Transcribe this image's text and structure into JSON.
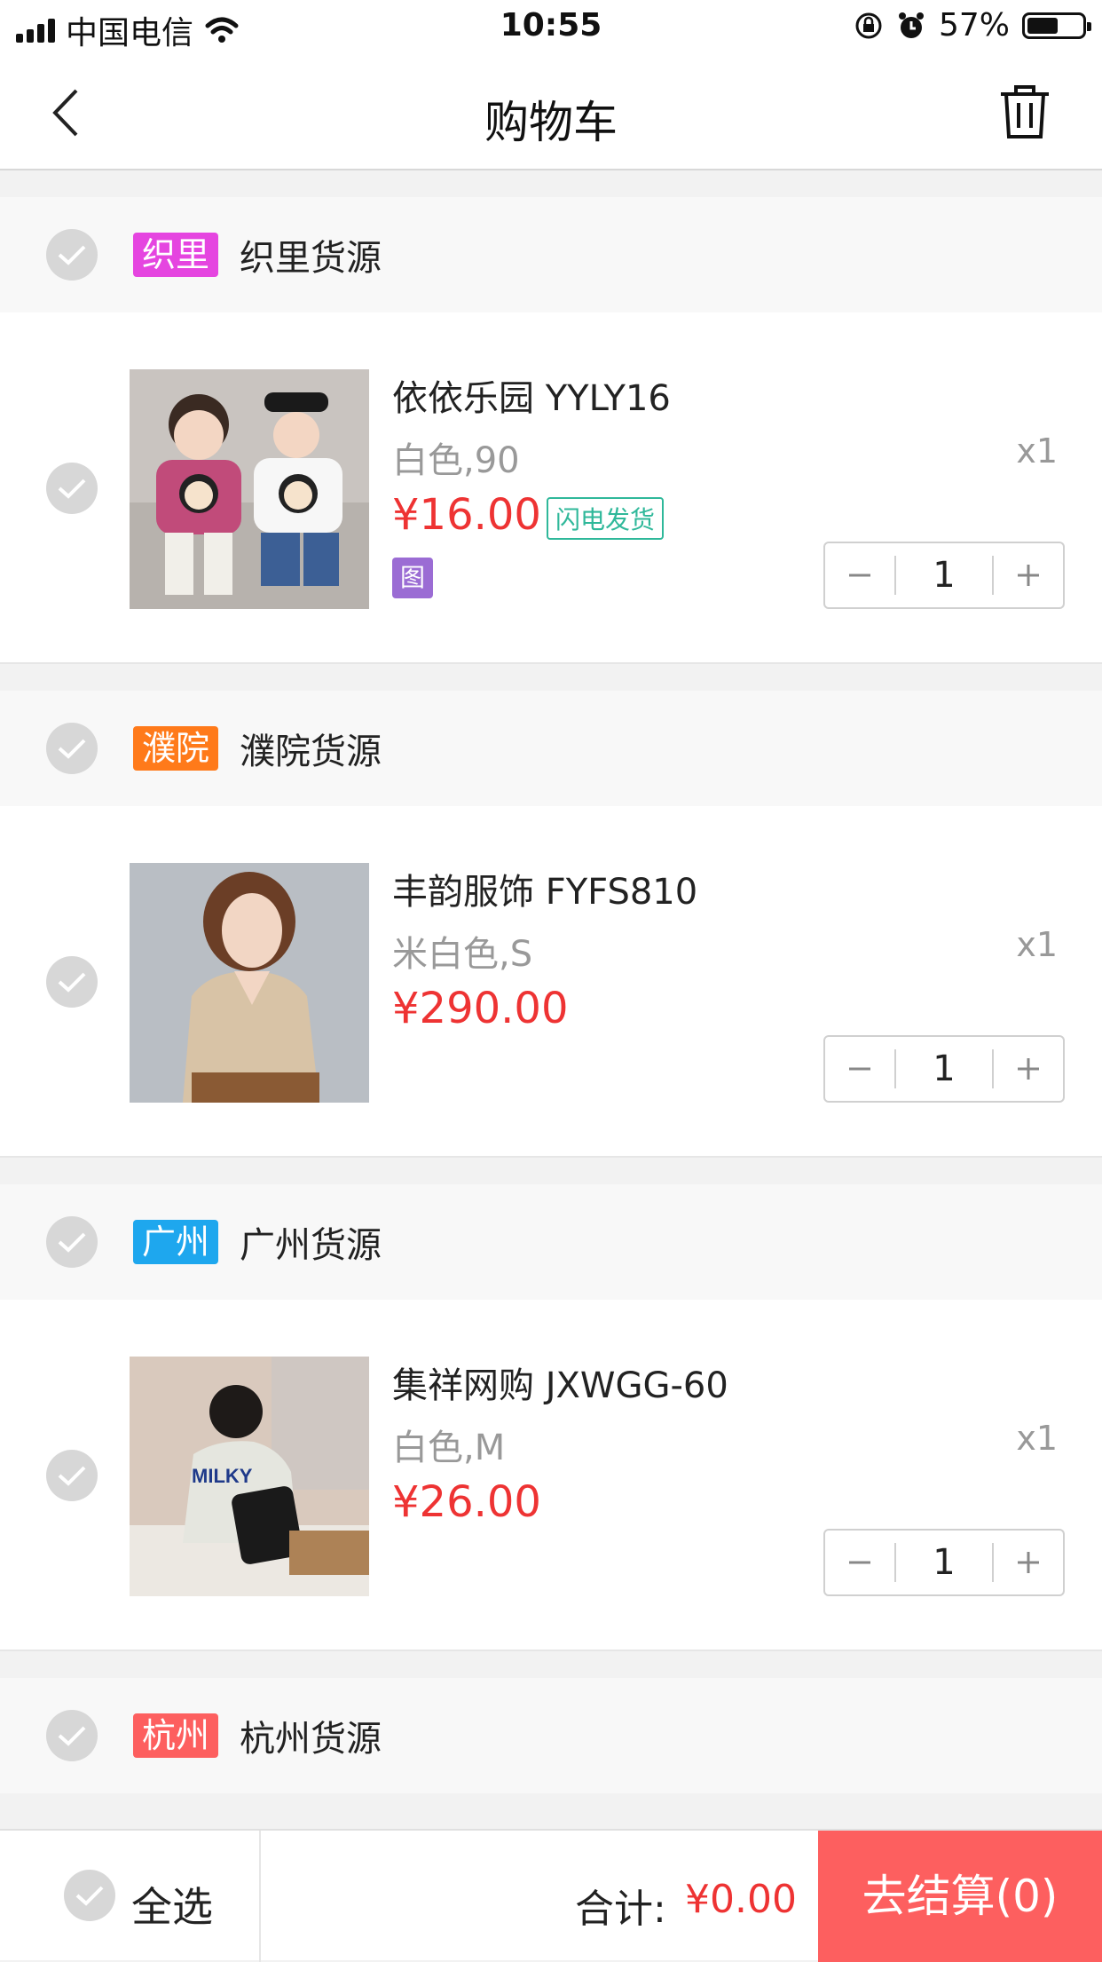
{
  "status_bar": {
    "carrier": "中国电信",
    "time": "10:55",
    "battery": "57%",
    "battery_level": 0.57
  },
  "nav": {
    "title": "购物车",
    "back_icon": "chevron-left-icon",
    "trash_icon": "trash-icon"
  },
  "shops": [
    {
      "tag": "织里",
      "tag_color": "#e545e0",
      "name": "织里货源",
      "item": {
        "title": "依依乐园 YYLY16",
        "spec": "白色,90",
        "price": "¥16.00",
        "qty_x": "x1",
        "quantity": "1",
        "flash_badge": "闪电发货",
        "img_badge": "图"
      }
    },
    {
      "tag": "濮院",
      "tag_color": "#ff7a1a",
      "name": "濮院货源",
      "item": {
        "title": "丰韵服饰 FYFS810",
        "spec": "米白色,S",
        "price": "¥290.00",
        "qty_x": "x1",
        "quantity": "1"
      }
    },
    {
      "tag": "广州",
      "tag_color": "#1ea7ee",
      "name": "广州货源",
      "item": {
        "title": "集祥网购 JXWGG-60",
        "spec": "白色,M",
        "price": "¥26.00",
        "qty_x": "x1",
        "quantity": "1",
        "thumb_text": "MILKY"
      }
    },
    {
      "tag": "杭州",
      "tag_color": "#fd5f5f",
      "name": "杭州货源"
    }
  ],
  "footer": {
    "select_all": "全选",
    "total_label": "合计:",
    "total_value": "¥0.00",
    "checkout": "去结算(0)"
  }
}
